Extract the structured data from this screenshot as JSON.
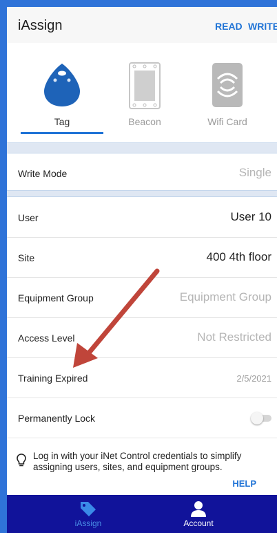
{
  "header": {
    "title": "iAssign",
    "read_label": "READ",
    "write_label": "WRITE"
  },
  "devices": [
    {
      "label": "Tag",
      "selected": true,
      "icon": "tag-icon"
    },
    {
      "label": "Beacon",
      "selected": false,
      "icon": "beacon-icon"
    },
    {
      "label": "Wifi Card",
      "selected": false,
      "icon": "wifi-card-icon"
    }
  ],
  "write_mode": {
    "label": "Write Mode",
    "value": "Single"
  },
  "fields": {
    "user": {
      "label": "User",
      "value": "User 10"
    },
    "site": {
      "label": "Site",
      "value": "400 4th floor"
    },
    "equipment_group": {
      "label": "Equipment Group",
      "value": "Equipment Group"
    },
    "access_level": {
      "label": "Access Level",
      "value": "Not Restricted"
    },
    "training_expired": {
      "label": "Training Expired",
      "value": "2/5/2021"
    },
    "permanently_lock": {
      "label": "Permanently Lock",
      "enabled": false
    }
  },
  "info": {
    "message": "Log in with your iNet Control credentials to simplify assigning users, sites, and equipment groups.",
    "help_label": "HELP",
    "icon": "lightbulb-icon"
  },
  "nav": [
    {
      "label": "iAssign",
      "icon": "tag-icon",
      "active": true
    },
    {
      "label": "Account",
      "icon": "account-icon",
      "active": false
    }
  ],
  "colors": {
    "accent": "#1f73d6",
    "nav_bg": "#11139a",
    "annotation_arrow": "#c0453a"
  }
}
